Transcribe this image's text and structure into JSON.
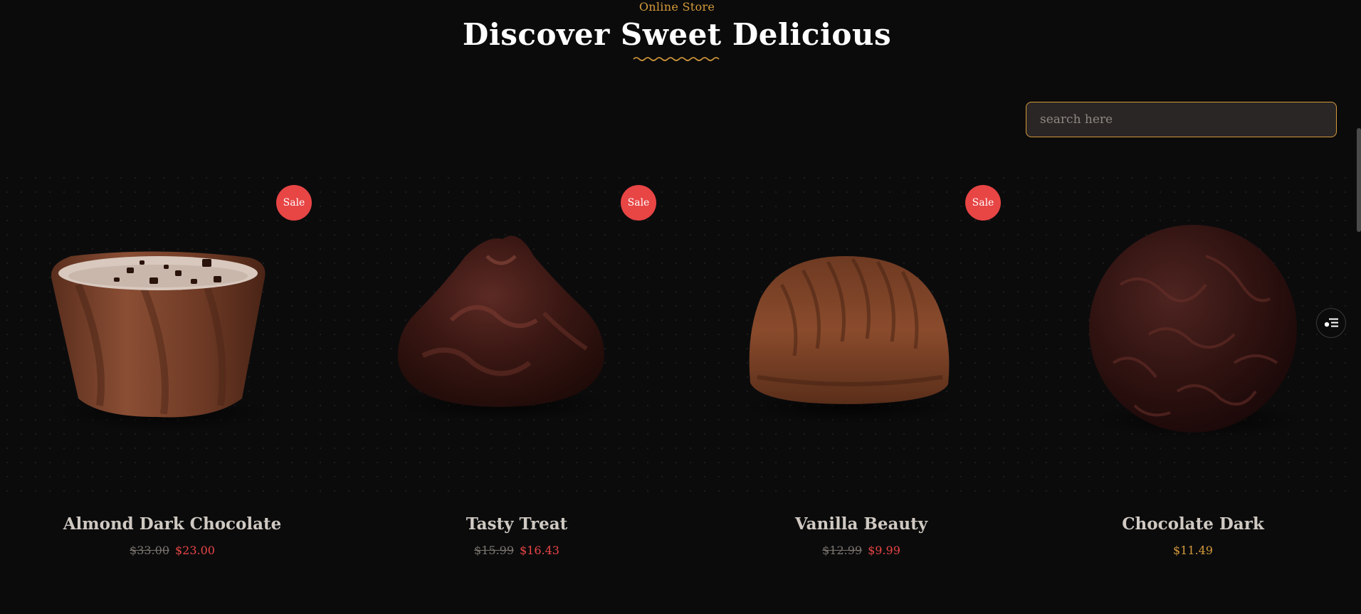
{
  "header": {
    "eyebrow": "Online Store",
    "title": "Discover Sweet Delicious"
  },
  "search": {
    "placeholder": "search here"
  },
  "products": [
    {
      "name": "Almond Dark Chocolate",
      "badge": "Sale",
      "old_price": "$33.00",
      "price": "$23.00"
    },
    {
      "name": "Tasty Treat",
      "badge": "Sale",
      "old_price": "$15.99",
      "price": "$16.43"
    },
    {
      "name": "Vanilla Beauty",
      "badge": "Sale",
      "old_price": "$12.99",
      "price": "$9.99"
    },
    {
      "name": "Chocolate Dark",
      "price": "$11.49"
    }
  ],
  "colors": {
    "background": "#0b0b0c",
    "accent": "#d49a3a",
    "sale": "#e84545"
  },
  "icons": [
    "wave-divider-icon",
    "filter-icon"
  ]
}
